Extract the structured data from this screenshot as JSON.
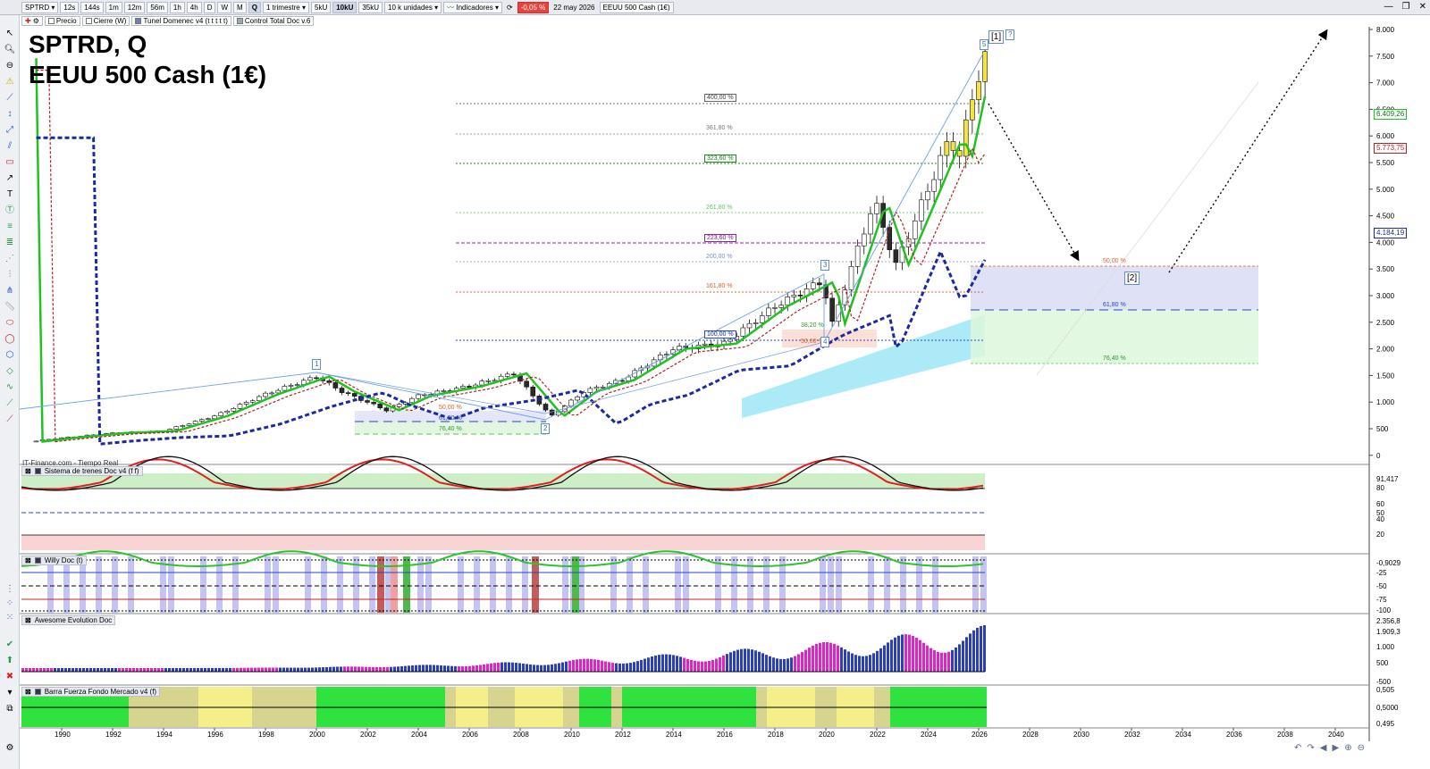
{
  "toolbar": {
    "symbol": "SPTRD",
    "timeframes": [
      "12s",
      "144s",
      "1m",
      "12m",
      "56m",
      "1h",
      "4h",
      "D",
      "W",
      "M",
      "Q"
    ],
    "period": "1 trimestre",
    "sizes": [
      "5kU",
      "10kU",
      "35kU"
    ],
    "active_size": "10kU",
    "units": "10 k unidades",
    "indicators": "Indicadores",
    "change": "-0,05 %",
    "date": "22 may 2026",
    "instrument": "EEUU 500 Cash (1€)"
  },
  "toolbar2": {
    "items": [
      "Precio",
      "Cierre (W)",
      "Tunel Domenec v4 (t t t t t)",
      "Control Total Doc v.6"
    ]
  },
  "title": {
    "line1": "SPTRD, Q",
    "line2": "EEUU 500 Cash (1€)"
  },
  "watermark": "IT-Finance.com - Tiempo Real",
  "panes": {
    "p1": "Sistema de trenes Doc v4 (f f)",
    "p2": "Willy Doc (t)",
    "p3": "Awesome Evolution Doc",
    "p4": "Barra Fuerza Fondo Mercado v4 (f)"
  },
  "fib_labels": {
    "f400": "400,00 %",
    "f361": "361,80 %",
    "f323": "323,60 %",
    "f261": "261,80 %",
    "f223": "223,60 %",
    "f200": "200,00 %",
    "f161": "161,80 %",
    "f100": "100,00 %",
    "f382": "38,20 %",
    "f50a": "50,00 %",
    "f50b": "50,00 %",
    "f618a": "61,80 %",
    "f764a": "76,40 %",
    "f50c": "50,00 %",
    "f618b": "61,80 %",
    "f764b": "76,40 %"
  },
  "waves": {
    "w1": "1",
    "w2": "2",
    "w3": "3",
    "w4": "4",
    "w5": "5",
    "wbig1": "[1]",
    "wbig2": "[2]",
    "wq": "?"
  },
  "price_axis": {
    "ticks": [
      "8.000",
      "7.500",
      "7.000",
      "6.500",
      "6.000",
      "5.500",
      "5.000",
      "4.500",
      "4.000",
      "3.500",
      "3.000",
      "2.500",
      "2.000",
      "1.500",
      "1.000",
      "500",
      "0"
    ],
    "flag_last": "6.409,26",
    "flag_mid": "5.773,75",
    "flag_low": "4.184,19"
  },
  "pane_axes": {
    "p1": [
      "91,417",
      "80",
      "60",
      "50",
      "40",
      "20"
    ],
    "p2": [
      "-0,9029",
      "-25",
      "-50",
      "-75",
      "-100"
    ],
    "p3": [
      "2.356,8",
      "1.909,3",
      "1.000",
      "500",
      "-500"
    ],
    "p4": [
      "0,505",
      "0,5000",
      "0,495"
    ]
  },
  "years": [
    "1990",
    "1992",
    "1994",
    "1996",
    "1998",
    "2000",
    "2002",
    "2004",
    "2006",
    "2008",
    "2010",
    "2012",
    "2014",
    "2016",
    "2018",
    "2020",
    "2022",
    "2024",
    "2026",
    "2028",
    "2030",
    "2032",
    "2034",
    "2036",
    "2038",
    "2040"
  ],
  "colors": {
    "fast_ma": "#1fc21f",
    "slow_ma": "#b22222",
    "long_ma": "#1b2a9e",
    "target_zone": "#d9dcf5",
    "lower_zone": "#ddf7dc",
    "cloud": "#8fe3f3"
  }
}
